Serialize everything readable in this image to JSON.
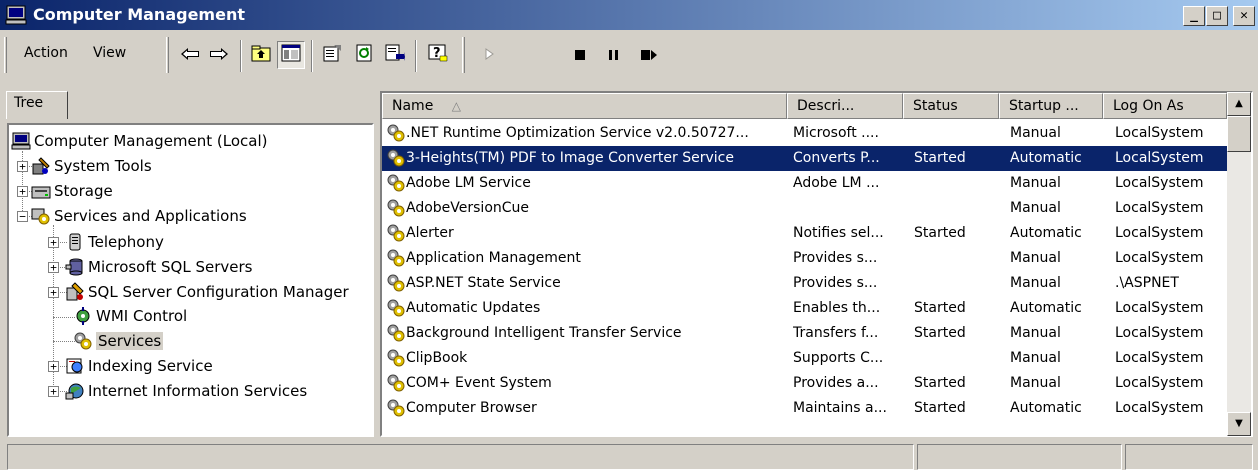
{
  "window": {
    "title": "Computer Management",
    "controls": {
      "minimize": "_",
      "maximize": "□",
      "close": "✕"
    }
  },
  "menu": {
    "action": "Action",
    "view": "View"
  },
  "toolbar": {
    "icons": [
      "back-arrow-icon",
      "forward-arrow-icon",
      "up-one-level-icon",
      "show-hide-tree-icon",
      "properties-icon",
      "refresh-icon",
      "export-list-icon",
      "help-icon",
      "start-service-icon",
      "stop-service-icon",
      "pause-service-icon",
      "restart-service-icon"
    ]
  },
  "tree": {
    "tab_label": "Tree",
    "nodes": [
      {
        "label": "Computer Management (Local)",
        "icon": "computer-icon"
      },
      {
        "label": "System Tools",
        "icon": "system-tools-icon"
      },
      {
        "label": "Storage",
        "icon": "storage-icon"
      },
      {
        "label": "Services and Applications",
        "icon": "services-apps-icon"
      },
      {
        "label": "Telephony",
        "icon": "telephony-icon"
      },
      {
        "label": "Microsoft SQL Servers",
        "icon": "sql-servers-icon"
      },
      {
        "label": "SQL Server Configuration Manager",
        "icon": "sql-config-icon"
      },
      {
        "label": "WMI Control",
        "icon": "wmi-icon"
      },
      {
        "label": "Services",
        "icon": "services-gear-icon"
      },
      {
        "label": "Indexing Service",
        "icon": "indexing-icon"
      },
      {
        "label": "Internet Information Services",
        "icon": "iis-icon"
      }
    ]
  },
  "list": {
    "columns": [
      "Name",
      "Descri...",
      "Status",
      "Startup ...",
      "Log On As"
    ],
    "sort_indicator": "△",
    "rows": [
      [
        ".NET Runtime Optimization Service v2.0.50727...",
        "Microsoft ....",
        "",
        "Manual",
        "LocalSystem"
      ],
      [
        "3-Heights(TM) PDF to Image Converter Service",
        "Converts P...",
        "Started",
        "Automatic",
        "LocalSystem"
      ],
      [
        "Adobe LM Service",
        "Adobe LM ...",
        "",
        "Manual",
        "LocalSystem"
      ],
      [
        "AdobeVersionCue",
        "",
        "",
        "Manual",
        "LocalSystem"
      ],
      [
        "Alerter",
        "Notifies sel...",
        "Started",
        "Automatic",
        "LocalSystem"
      ],
      [
        "Application Management",
        "Provides s...",
        "",
        "Manual",
        "LocalSystem"
      ],
      [
        "ASP.NET State Service",
        "Provides s...",
        "",
        "Manual",
        ".\\ASPNET"
      ],
      [
        "Automatic Updates",
        "Enables th...",
        "Started",
        "Automatic",
        "LocalSystem"
      ],
      [
        "Background Intelligent Transfer Service",
        "Transfers f...",
        "Started",
        "Manual",
        "LocalSystem"
      ],
      [
        "ClipBook",
        "Supports C...",
        "",
        "Manual",
        "LocalSystem"
      ],
      [
        "COM+ Event System",
        "Provides a...",
        "Started",
        "Manual",
        "LocalSystem"
      ],
      [
        "Computer Browser",
        "Maintains a...",
        "Started",
        "Automatic",
        "LocalSystem"
      ]
    ],
    "selected_row": 1
  },
  "colors": {
    "titlebar_start": "#0a246a",
    "titlebar_end": "#a6caf0",
    "selection": "#0a246a",
    "face": "#d4d0c8"
  }
}
